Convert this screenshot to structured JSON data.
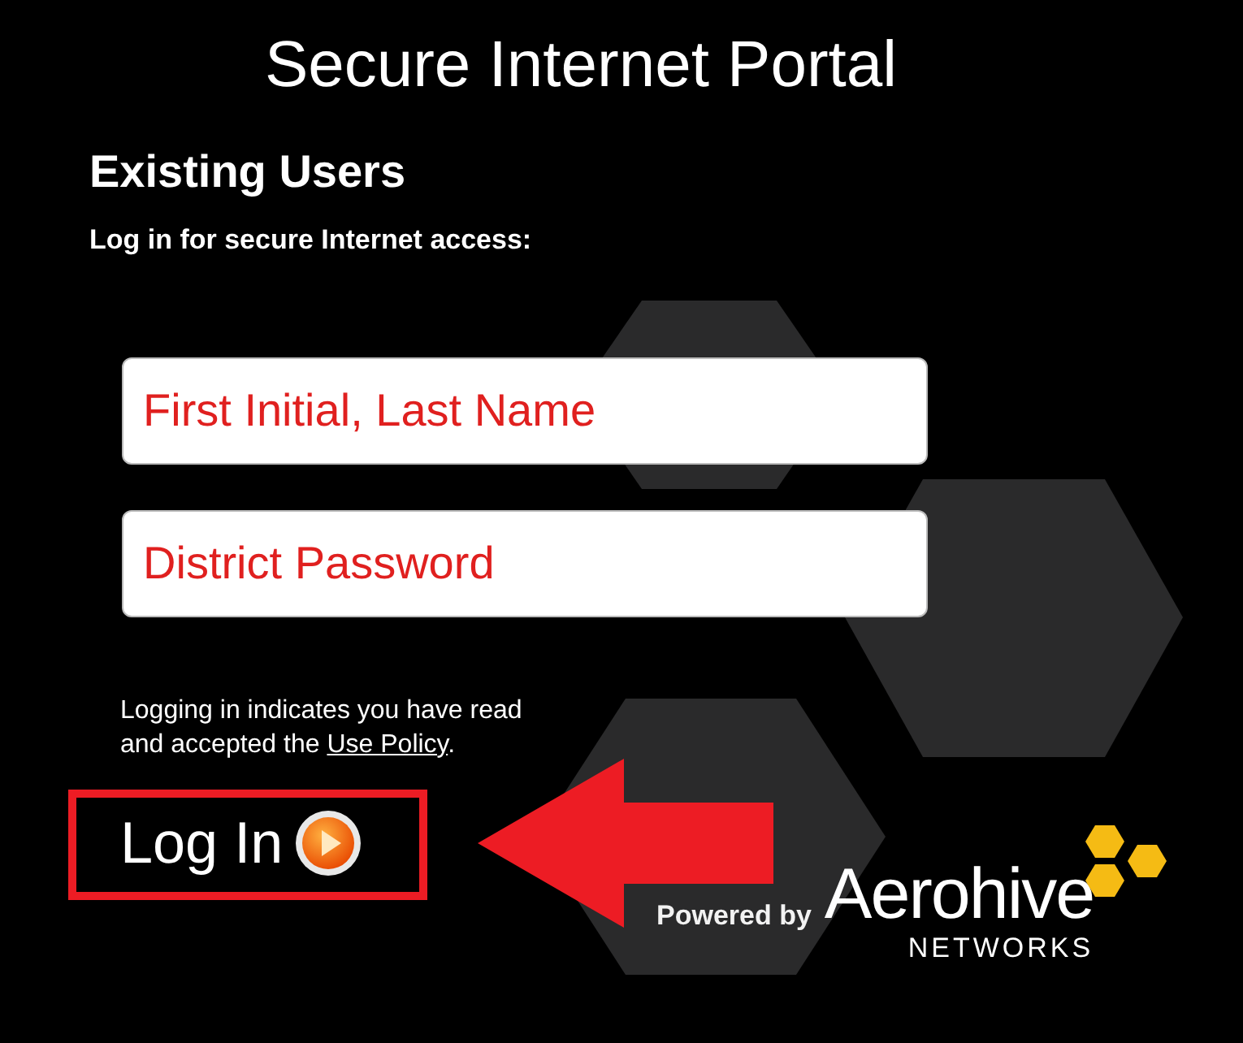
{
  "title": "Secure Internet Portal",
  "heading": "Existing Users",
  "subheading": "Log in for secure Internet access:",
  "fields": [
    {
      "placeholder": "First Initial, Last Name"
    },
    {
      "placeholder": "District Password"
    }
  ],
  "notice": {
    "before": "Logging in indicates you have read and accepted the ",
    "link": "Use Policy",
    "after": "."
  },
  "login_button": {
    "label": "Log In"
  },
  "footer": {
    "powered_by": "Powered by",
    "brand": "Aerohive",
    "brand_sub": "NETWORKS"
  }
}
